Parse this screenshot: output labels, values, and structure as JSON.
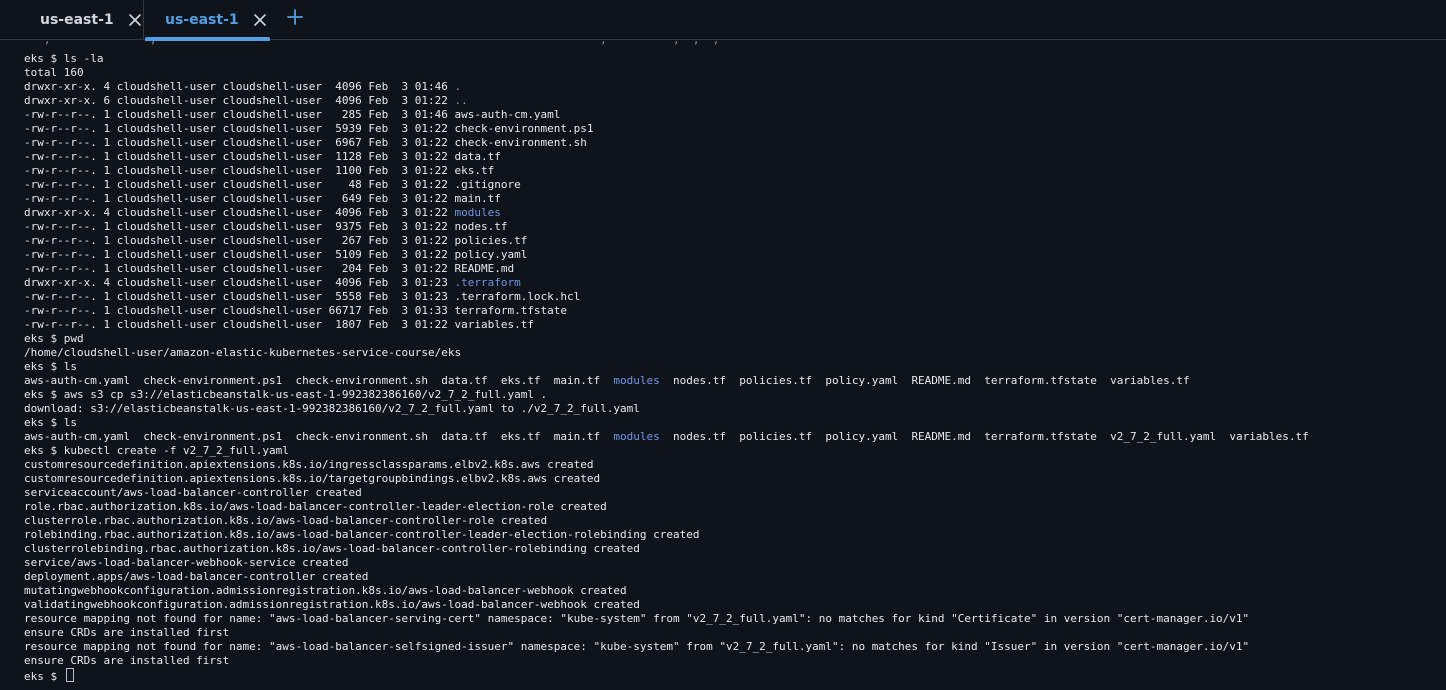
{
  "tabs": [
    {
      "label": "us-east-1",
      "active": false
    },
    {
      "label": "us-east-1",
      "active": true
    }
  ],
  "icons": {
    "close": "close-icon",
    "add": "plus-icon"
  },
  "colors": {
    "background": "#0f141a",
    "active_tab": "#539fe5",
    "directory": "#6f95e6",
    "text": "#e7eaee"
  },
  "terminal": {
    "lines": [
      [
        {
          "t": "eks $ ls -la"
        }
      ],
      [
        {
          "t": "total 160"
        }
      ],
      [
        {
          "t": "drwxr-xr-x. 4 cloudshell-user cloudshell-user  4096 Feb  3 01:46 "
        },
        {
          "t": ".",
          "dir": true
        }
      ],
      [
        {
          "t": "drwxr-xr-x. 6 cloudshell-user cloudshell-user  4096 Feb  3 01:22 "
        },
        {
          "t": "..",
          "dir": true
        }
      ],
      [
        {
          "t": "-rw-r--r--. 1 cloudshell-user cloudshell-user   285 Feb  3 01:46 aws-auth-cm.yaml"
        }
      ],
      [
        {
          "t": "-rw-r--r--. 1 cloudshell-user cloudshell-user  5939 Feb  3 01:22 check-environment.ps1"
        }
      ],
      [
        {
          "t": "-rw-r--r--. 1 cloudshell-user cloudshell-user  6967 Feb  3 01:22 check-environment.sh"
        }
      ],
      [
        {
          "t": "-rw-r--r--. 1 cloudshell-user cloudshell-user  1128 Feb  3 01:22 data.tf"
        }
      ],
      [
        {
          "t": "-rw-r--r--. 1 cloudshell-user cloudshell-user  1100 Feb  3 01:22 eks.tf"
        }
      ],
      [
        {
          "t": "-rw-r--r--. 1 cloudshell-user cloudshell-user    48 Feb  3 01:22 .gitignore"
        }
      ],
      [
        {
          "t": "-rw-r--r--. 1 cloudshell-user cloudshell-user   649 Feb  3 01:22 main.tf"
        }
      ],
      [
        {
          "t": "drwxr-xr-x. 4 cloudshell-user cloudshell-user  4096 Feb  3 01:22 "
        },
        {
          "t": "modules",
          "dir": true
        }
      ],
      [
        {
          "t": "-rw-r--r--. 1 cloudshell-user cloudshell-user  9375 Feb  3 01:22 nodes.tf"
        }
      ],
      [
        {
          "t": "-rw-r--r--. 1 cloudshell-user cloudshell-user   267 Feb  3 01:22 policies.tf"
        }
      ],
      [
        {
          "t": "-rw-r--r--. 1 cloudshell-user cloudshell-user  5109 Feb  3 01:22 policy.yaml"
        }
      ],
      [
        {
          "t": "-rw-r--r--. 1 cloudshell-user cloudshell-user   204 Feb  3 01:22 README.md"
        }
      ],
      [
        {
          "t": "drwxr-xr-x. 4 cloudshell-user cloudshell-user  4096 Feb  3 01:23 "
        },
        {
          "t": ".terraform",
          "dir": true
        }
      ],
      [
        {
          "t": "-rw-r--r--. 1 cloudshell-user cloudshell-user  5558 Feb  3 01:23 .terraform.lock.hcl"
        }
      ],
      [
        {
          "t": "-rw-r--r--. 1 cloudshell-user cloudshell-user 66717 Feb  3 01:33 terraform.tfstate"
        }
      ],
      [
        {
          "t": "-rw-r--r--. 1 cloudshell-user cloudshell-user  1807 Feb  3 01:22 variables.tf"
        }
      ],
      [
        {
          "t": "eks $ pwd"
        }
      ],
      [
        {
          "t": "/home/cloudshell-user/amazon-elastic-kubernetes-service-course/eks"
        }
      ],
      [
        {
          "t": "eks $ ls"
        }
      ],
      [
        {
          "t": "aws-auth-cm.yaml  check-environment.ps1  check-environment.sh  data.tf  eks.tf  main.tf  "
        },
        {
          "t": "modules",
          "dir": true
        },
        {
          "t": "  nodes.tf  policies.tf  policy.yaml  README.md  terraform.tfstate  variables.tf"
        }
      ],
      [
        {
          "t": "eks $ aws s3 cp s3://elasticbeanstalk-us-east-1-992382386160/v2_7_2_full.yaml ."
        }
      ],
      [
        {
          "t": "download: s3://elasticbeanstalk-us-east-1-992382386160/v2_7_2_full.yaml to ./v2_7_2_full.yaml"
        }
      ],
      [
        {
          "t": "eks $ ls"
        }
      ],
      [
        {
          "t": "aws-auth-cm.yaml  check-environment.ps1  check-environment.sh  data.tf  eks.tf  main.tf  "
        },
        {
          "t": "modules",
          "dir": true
        },
        {
          "t": "  nodes.tf  policies.tf  policy.yaml  README.md  terraform.tfstate  v2_7_2_full.yaml  variables.tf"
        }
      ],
      [
        {
          "t": "eks $ kubectl create -f v2_7_2_full.yaml"
        }
      ],
      [
        {
          "t": "customresourcedefinition.apiextensions.k8s.io/ingressclassparams.elbv2.k8s.aws created"
        }
      ],
      [
        {
          "t": "customresourcedefinition.apiextensions.k8s.io/targetgroupbindings.elbv2.k8s.aws created"
        }
      ],
      [
        {
          "t": "serviceaccount/aws-load-balancer-controller created"
        }
      ],
      [
        {
          "t": "role.rbac.authorization.k8s.io/aws-load-balancer-controller-leader-election-role created"
        }
      ],
      [
        {
          "t": "clusterrole.rbac.authorization.k8s.io/aws-load-balancer-controller-role created"
        }
      ],
      [
        {
          "t": "rolebinding.rbac.authorization.k8s.io/aws-load-balancer-controller-leader-election-rolebinding created"
        }
      ],
      [
        {
          "t": "clusterrolebinding.rbac.authorization.k8s.io/aws-load-balancer-controller-rolebinding created"
        }
      ],
      [
        {
          "t": "service/aws-load-balancer-webhook-service created"
        }
      ],
      [
        {
          "t": "deployment.apps/aws-load-balancer-controller created"
        }
      ],
      [
        {
          "t": "mutatingwebhookconfiguration.admissionregistration.k8s.io/aws-load-balancer-webhook created"
        }
      ],
      [
        {
          "t": "validatingwebhookconfiguration.admissionregistration.k8s.io/aws-load-balancer-webhook created"
        }
      ],
      [
        {
          "t": "resource mapping not found for name: \"aws-load-balancer-serving-cert\" namespace: \"kube-system\" from \"v2_7_2_full.yaml\": no matches for kind \"Certificate\" in version \"cert-manager.io/v1\""
        }
      ],
      [
        {
          "t": "ensure CRDs are installed first"
        }
      ],
      [
        {
          "t": "resource mapping not found for name: \"aws-load-balancer-selfsigned-issuer\" namespace: \"kube-system\" from \"v2_7_2_full.yaml\": no matches for kind \"Issuer\" in version \"cert-manager.io/v1\""
        }
      ],
      [
        {
          "t": "ensure CRDs are installed first"
        }
      ]
    ],
    "prompt": "eks $ "
  }
}
